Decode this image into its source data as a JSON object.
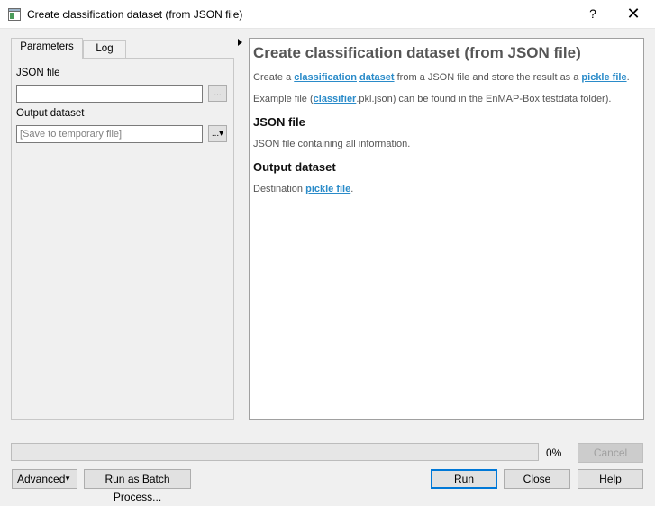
{
  "window": {
    "title": "Create classification dataset (from JSON file)",
    "help_glyph": "?",
    "close_glyph": "✕"
  },
  "tabs": [
    {
      "label": "Parameters",
      "active": true
    },
    {
      "label": "Log",
      "active": false
    }
  ],
  "parameters": {
    "json_file": {
      "label": "JSON file",
      "value": "",
      "browse_label": "..."
    },
    "output_dataset": {
      "label": "Output dataset",
      "value": "",
      "placeholder": "[Save to temporary file]",
      "browse_label": "...▾"
    }
  },
  "help": {
    "title": "Create classification dataset (from JSON file)",
    "intro": {
      "t1": "Create a ",
      "link1": "classification",
      "t2": " ",
      "link2": "dataset",
      "t3": " from a JSON file and store the result as a ",
      "link3": "pickle file",
      "t4": "."
    },
    "example": {
      "t1": "Example file (",
      "link1": "classifier",
      "t2": ".pkl.json) can be found in the EnMAP-Box testdata folder)."
    },
    "json_section": {
      "heading": "JSON file",
      "text": "JSON file containing all information."
    },
    "output_section": {
      "heading": "Output dataset",
      "t1": "Destination ",
      "link1": "pickle file",
      "t2": "."
    }
  },
  "progress": {
    "value": 0,
    "label": "0%"
  },
  "buttons": {
    "cancel": "Cancel",
    "advanced": "Advanced",
    "batch": "Run as Batch Process...",
    "run": "Run",
    "close": "Close",
    "help": "Help"
  },
  "colors": {
    "link": "#2a8bc9",
    "accent": "#0078d7"
  },
  "icons": {
    "app": "processing-dialog-icon",
    "collapse": "triangle-right-icon"
  }
}
